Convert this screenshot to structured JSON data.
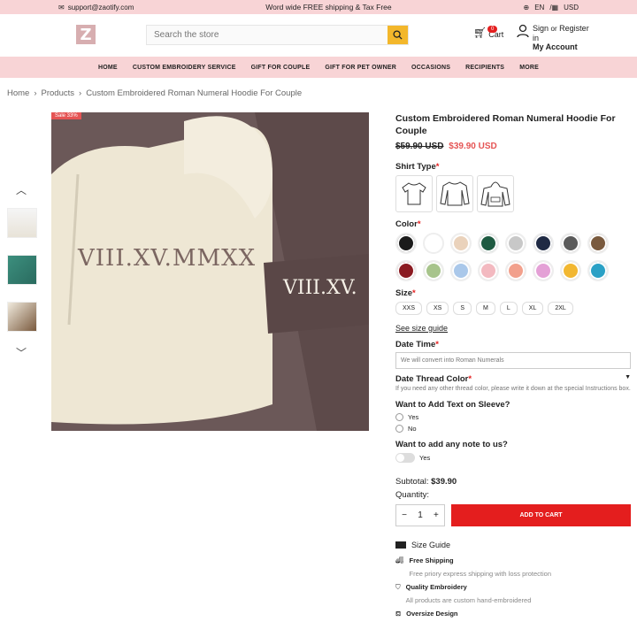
{
  "topbar": {
    "email": "support@zaotify.com",
    "promo": "Word wide FREE shipping & Tax Free",
    "lang": "EN",
    "currency": "USD"
  },
  "header": {
    "logo": "Z",
    "search_placeholder": "Search the store",
    "cart_count": "0",
    "cart_label": "Cart",
    "sign": "Sign",
    "or": "or",
    "register": "Register",
    "in": "in",
    "account": "My Account"
  },
  "nav": [
    "HOME",
    "CUSTOM EMBROIDERY SERVICE",
    "GIFT FOR COUPLE",
    "GIFT FOR PET OWNER",
    "OCCASIONS",
    "RECIPIENTS",
    "MORE"
  ],
  "breadcrumb": [
    "Home",
    "Products",
    "Custom Embroidered Roman Numeral Hoodie For Couple"
  ],
  "sale_badge": "Sale 33%",
  "image_text": {
    "left": "VIII.XV.MMXX",
    "right": "VIII.XV."
  },
  "product": {
    "title": "Custom Embroidered Roman Numeral Hoodie For Couple",
    "old_price": "$59.90 USD",
    "price": "$39.90 USD",
    "shirt_type_label": "Shirt Type",
    "color_label": "Color",
    "colors": [
      "#1b1b1b",
      "#ffffff",
      "#ead2bb",
      "#1e5b42",
      "#c8c8c8",
      "#1f2a44",
      "#5a5a5a",
      "#7a5a3e",
      "#8b1a21",
      "#a7c48b",
      "#aac8ea",
      "#f3b9c0",
      "#f2a08c",
      "#e4a0d6",
      "#f2b730",
      "#2aa1c6"
    ],
    "size_label": "Size",
    "sizes": [
      "XXS",
      "XS",
      "S",
      "M",
      "L",
      "XL",
      "2XL"
    ],
    "size_guide_link": "See size guide",
    "date_label": "Date Time",
    "date_placeholder": "We will convert into Roman Numerals",
    "thread_label": "Date Thread Color",
    "thread_note": "If you need any other thread color, please write it down at the special Instructions box.",
    "sleeve_label": "Want to Add Text on Sleeve?",
    "yes": "Yes",
    "no": "No",
    "note_label": "Want to add any note to us?",
    "note_yes": "Yes",
    "subtotal_label": "Subtotal:",
    "subtotal": "$39.90",
    "qty_label": "Quantity:",
    "qty": "1",
    "add_to_cart": "ADD TO CART",
    "size_guide": "Size Guide",
    "features": [
      {
        "title": "Free Shipping",
        "sub": "Free priory express shipping with loss protection"
      },
      {
        "title": "Quality Embroidery",
        "sub": "All products are custom hand-embroidered"
      },
      {
        "title": "Oversize Design",
        "sub": ""
      }
    ]
  }
}
